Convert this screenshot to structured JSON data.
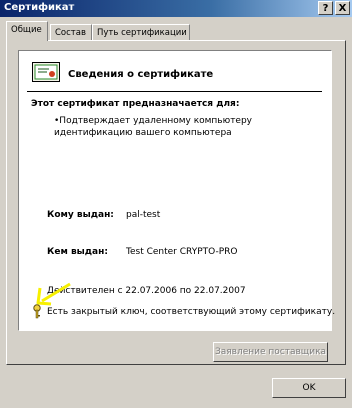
{
  "window": {
    "title": "Сертификат",
    "help": "?",
    "close": "X"
  },
  "tabs": [
    "Общие",
    "Состав",
    "Путь сертификации"
  ],
  "info": {
    "heading": "Сведения о сертификате",
    "purpose_label": "Этот сертификат предназначается для:",
    "purpose_items": [
      "•Подтверждает удаленному компьютеру идентификацию вашего компьютера"
    ],
    "issued_to_label": "Кому выдан:",
    "issued_to_value": "pal-test",
    "issued_by_label": "Кем выдан:",
    "issued_by_value": "Test Center CRYPTO-PRO",
    "validity_text": "Действителен с 22.07.2006 по 22.07.2007",
    "private_key_text": "Есть закрытый ключ, соответствующий этому сертификату."
  },
  "buttons": {
    "issuer_statement": "Заявление поставщика",
    "ok": "OK"
  },
  "colors": {
    "arrow": "#f7f000",
    "titlebar": "#0a246a"
  }
}
